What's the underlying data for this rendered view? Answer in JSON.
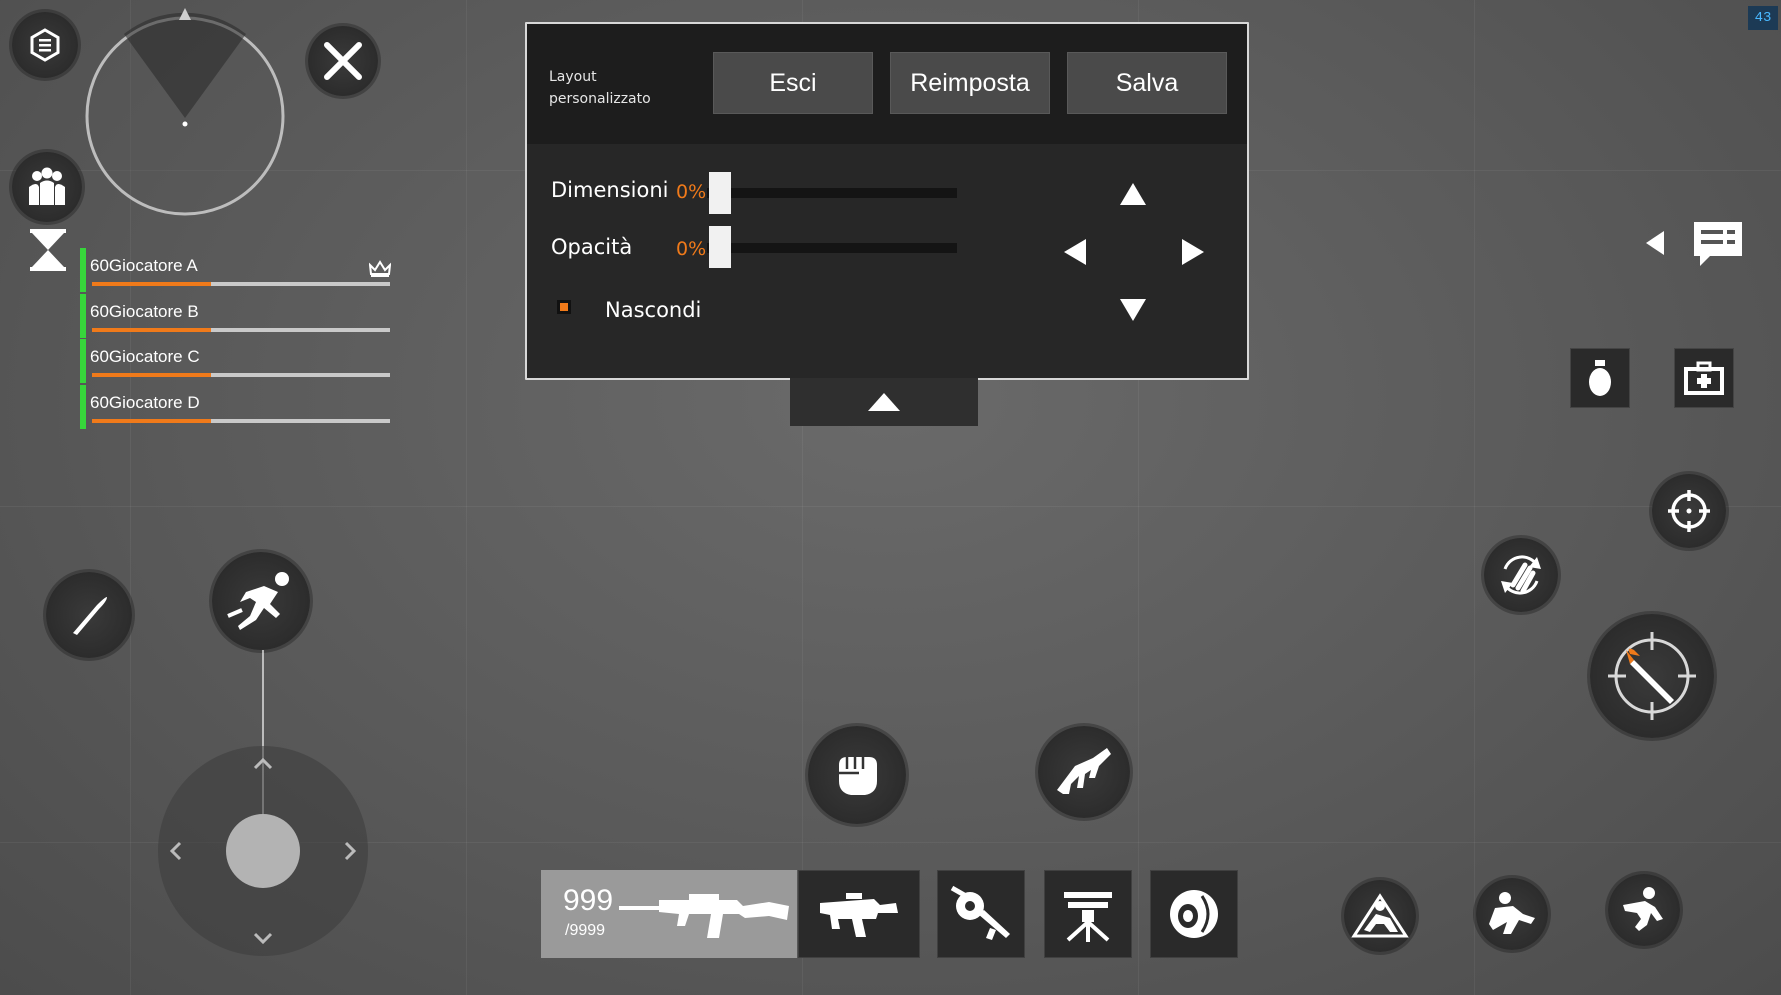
{
  "panel": {
    "title": "Layout personalizzato",
    "buttons": {
      "exit": "Esci",
      "reset": "Reimposta",
      "save": "Salva"
    },
    "size": {
      "label": "Dimensioni",
      "value": "0%"
    },
    "opacity": {
      "label": "Opacità",
      "value": "0%"
    },
    "hide": {
      "label": "Nascondi",
      "checked": true
    }
  },
  "team": [
    {
      "name": "60Giocatore A",
      "health": 0.4,
      "leader": true
    },
    {
      "name": "60Giocatore B",
      "health": 0.4
    },
    {
      "name": "60Giocatore C",
      "health": 0.4
    },
    {
      "name": "60Giocatore D",
      "health": 0.4
    }
  ],
  "weapon": {
    "ammo": "999",
    "reserve": "/9999"
  },
  "fps": "43",
  "colors": {
    "accent": "#f07a1a",
    "team": "#37d63b",
    "panel": "#272727"
  },
  "icons": [
    "menu-icon",
    "close-icon",
    "team-icon",
    "hourglass-icon",
    "crown-icon",
    "chat-icon",
    "grenade-icon",
    "medkit-icon",
    "crosshair-icon",
    "reload-icon",
    "fire-icon",
    "knife-icon",
    "sprint-icon",
    "punch-icon",
    "grab-icon",
    "crouch-icon",
    "prone-icon",
    "jump-icon"
  ]
}
